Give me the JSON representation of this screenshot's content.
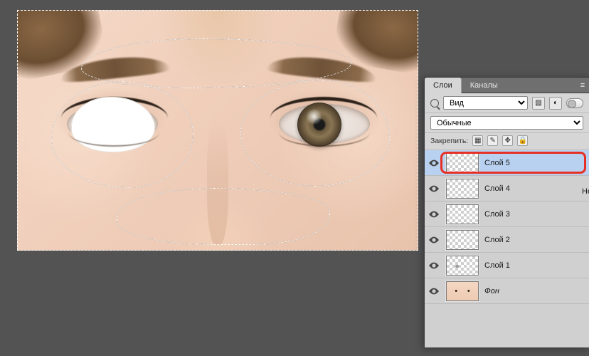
{
  "panel": {
    "tabs": {
      "layers": "Слои",
      "channels": "Каналы"
    },
    "filter": {
      "label": "Вид"
    },
    "blend_mode": "Обычные",
    "opacity_label_fragment": "Не",
    "lock_label": "Закрепить:"
  },
  "layers": [
    {
      "name": "Слой 5",
      "visible": true,
      "selected": true,
      "highlighted": true,
      "thumb": "checker"
    },
    {
      "name": "Слой 4",
      "visible": true,
      "selected": false,
      "highlighted": false,
      "thumb": "checker"
    },
    {
      "name": "Слой 3",
      "visible": true,
      "selected": false,
      "highlighted": false,
      "thumb": "checker"
    },
    {
      "name": "Слой 2",
      "visible": true,
      "selected": false,
      "highlighted": false,
      "thumb": "checker"
    },
    {
      "name": "Слой 1",
      "visible": true,
      "selected": false,
      "highlighted": false,
      "thumb": "checker-dot"
    },
    {
      "name": "Фон",
      "visible": true,
      "selected": false,
      "highlighted": false,
      "thumb": "face",
      "background": true
    }
  ]
}
